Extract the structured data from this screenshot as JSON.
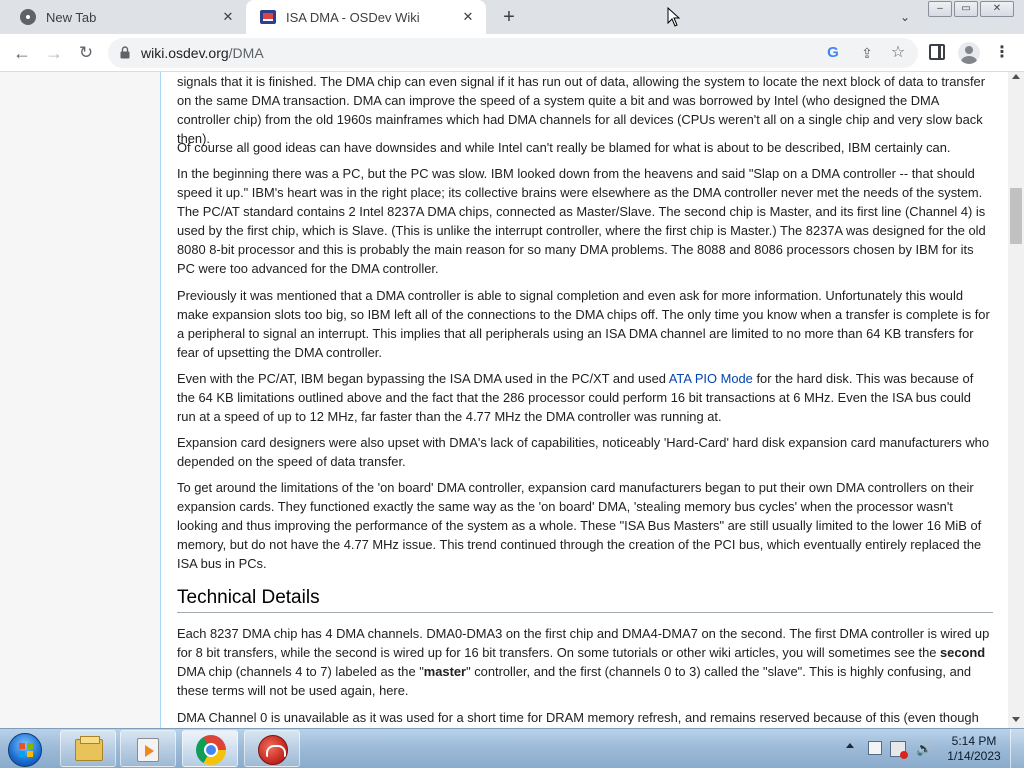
{
  "browser": {
    "tabs": [
      {
        "title": "New Tab",
        "close_label": "✕"
      },
      {
        "title": "ISA DMA - OSDev Wiki",
        "close_label": "✕"
      }
    ],
    "new_tab_label": "+",
    "tab_search_label": "⌄",
    "window_controls": {
      "minimize": "–",
      "maximize": "▭",
      "close": "✕"
    },
    "nav": {
      "back": "←",
      "forward": "→",
      "reload": "↻"
    },
    "url_host": "wiki.osdev.org",
    "url_path": "/DMA",
    "omnibox_icons": {
      "google": "G",
      "share": "⇪",
      "bookmark": "☆"
    },
    "menu_label": "⋮"
  },
  "article": {
    "p1_line": "signals that it is finished. The DMA chip can even signal if it has run out of data, allowing the system to locate the next block of data to transfer on the same DMA transaction. DMA can improve the speed of a system quite a bit and was borrowed by Intel (who designed the DMA controller chip) from the old 1960s mainframes which had DMA channels for all devices (CPUs weren't all on a single chip and very slow back then).",
    "p2": "Of course all good ideas can have downsides and while Intel can't really be blamed for what is about to be described, IBM certainly can.",
    "p3": "In the beginning there was a PC, but the PC was slow. IBM looked down from the heavens and said \"Slap on a DMA controller -- that should speed it up.\" IBM's heart was in the right place; its collective brains were elsewhere as the DMA controller never met the needs of the system. The PC/AT standard contains 2 Intel 8237A DMA chips, connected as Master/Slave. The second chip is Master, and its first line (Channel 4) is used by the first chip, which is Slave. (This is unlike the interrupt controller, where the first chip is Master.) The 8237A was designed for the old 8080 8-bit processor and this is probably the main reason for so many DMA problems. The 8088 and 8086 processors chosen by IBM for its PC were too advanced for the DMA controller.",
    "p4": "Previously it was mentioned that a DMA controller is able to signal completion and even ask for more information. Unfortunately this would make expansion slots too big, so IBM left all of the connections to the DMA chips off. The only time you know when a transfer is complete is for a peripheral to signal an interrupt. This implies that all peripherals using an ISA DMA channel are limited to no more than 64 KB transfers for fear of upsetting the DMA controller.",
    "p5_before_link": "Even with the PC/AT, IBM began bypassing the ISA DMA used in the PC/XT and used ",
    "p5_link": "ATA PIO Mode",
    "p5_after_link": " for the hard disk. This was because of the 64 KB limitations outlined above and the fact that the 286 processor could perform 16 bit transactions at 6 MHz. Even the ISA bus could run at a speed of up to 12 MHz, far faster than the 4.77 MHz the DMA controller was running at.",
    "p6": "Expansion card designers were also upset with DMA's lack of capabilities, noticeably 'Hard-Card' hard disk expansion card manufacturers who depended on the speed of data transfer.",
    "p7": "To get around the limitations of the 'on board' DMA controller, expansion card manufacturers began to put their own DMA controllers on their expansion cards. They functioned exactly the same way as the 'on board' DMA, 'stealing memory bus cycles' when the processor wasn't looking and thus improving the performance of the system as a whole. These \"ISA Bus Masters\" are still usually limited to the lower 16 MiB of memory, but do not have the 4.77 MHz issue. This trend continued through the creation of the PCI bus, which eventually entirely replaced the ISA bus in PCs.",
    "heading": "Technical Details",
    "p8_a": "Each 8237 DMA chip has 4 DMA channels. DMA0-DMA3 on the first chip and DMA4-DMA7 on the second. The first DMA controller is wired up for 8 bit transfers, while the second is wired up for 16 bit transfers. On some tutorials or other wiki articles, you will sometimes see the ",
    "p8_b1": "second",
    "p8_c": " DMA chip (channels 4 to 7) labeled as the \"",
    "p8_b2": "master",
    "p8_d": "\" controller, and the first (channels 0 to 3) called the \"slave\". This is highly confusing, and these terms will not be used again, here.",
    "p9": "DMA Channel 0 is unavailable as it was used for a short time for DRAM memory refresh, and remains reserved because of this (even though"
  },
  "taskbar": {
    "clock_time": "5:14 PM",
    "clock_date": "1/14/2023",
    "volume_icon": "🔊"
  },
  "colors": {
    "link": "#0645ad",
    "tabstrip": "#dee1e6",
    "taskbar": "#9ebbd8"
  }
}
